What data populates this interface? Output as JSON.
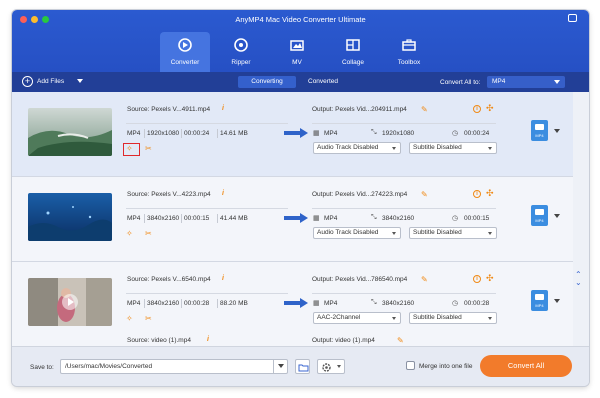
{
  "window": {
    "title": "AnyMP4 Mac Video Converter Ultimate"
  },
  "nav": [
    {
      "label": "Converter",
      "icon": "converter-icon",
      "active": true
    },
    {
      "label": "Ripper",
      "icon": "ripper-icon"
    },
    {
      "label": "MV",
      "icon": "mv-icon"
    },
    {
      "label": "Collage",
      "icon": "collage-icon"
    },
    {
      "label": "Toolbox",
      "icon": "toolbox-icon"
    }
  ],
  "toolbar": {
    "add_files": "Add Files",
    "tabs": [
      "Converting",
      "Converted"
    ],
    "convert_all_to_label": "Convert All to:",
    "convert_all_to_value": "MP4"
  },
  "files": [
    {
      "source": "Source: Pexels V...4911.mp4",
      "format": "MP4",
      "resolution": "1920x1080",
      "duration": "00:00:24",
      "size": "14.61 MB",
      "output": "Output: Pexels Vid...204911.mp4",
      "out_format": "MP4",
      "out_resolution": "1920x1080",
      "out_duration": "00:00:24",
      "audio": "Audio Track Disabled",
      "subtitle": "Subtitle Disabled",
      "selected": true
    },
    {
      "source": "Source: Pexels V...4223.mp4",
      "format": "MP4",
      "resolution": "3840x2160",
      "duration": "00:00:15",
      "size": "41.44 MB",
      "output": "Output: Pexels Vid...274223.mp4",
      "out_format": "MP4",
      "out_resolution": "3840x2160",
      "out_duration": "00:00:15",
      "audio": "Audio Track Disabled",
      "subtitle": "Subtitle Disabled"
    },
    {
      "source": "Source: Pexels V...6540.mp4",
      "format": "MP4",
      "resolution": "3840x2160",
      "duration": "00:00:28",
      "size": "88.20 MB",
      "output": "Output: Pexels Vid...786540.mp4",
      "out_format": "MP4",
      "out_resolution": "3840x2160",
      "out_duration": "00:00:28",
      "audio": "AAC-2Channel",
      "subtitle": "Subtitle Disabled"
    },
    {
      "source": "Source: video (1).mp4",
      "output": "Output: video (1).mp4"
    }
  ],
  "format_badge": "MP4",
  "footer": {
    "save_to": "Save to:",
    "path": "/Users/mac/Movies/Converted",
    "merge_label": "Merge into one file",
    "convert_all": "Convert All"
  },
  "colors": {
    "accent": "#2650c4",
    "dark_bar": "#223f97",
    "orange": "#f27b2b",
    "highlight": "#e0282b"
  }
}
